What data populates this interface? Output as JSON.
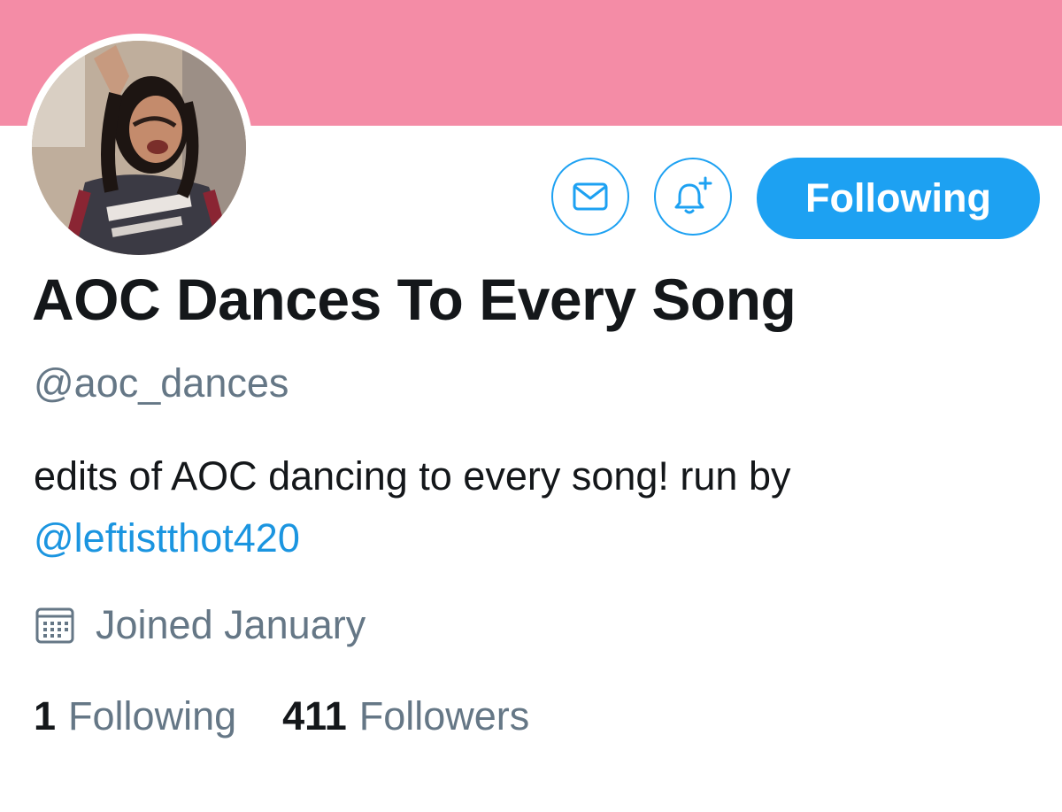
{
  "colors": {
    "banner": "#f48ca6",
    "accent": "#1da1f2",
    "link": "#1b95e0",
    "secondary_text": "#657786",
    "primary_text": "#14171a"
  },
  "profile": {
    "display_name": "AOC Dances To Every Song",
    "handle": "@aoc_dances",
    "bio_text": "edits of AOC dancing to every song! run by ",
    "bio_mention": "@leftistthot420",
    "joined": "Joined January",
    "avatar_icon": "profile-photo"
  },
  "actions": {
    "message_icon": "envelope-icon",
    "notify_icon": "bell-plus-icon",
    "follow_label": "Following"
  },
  "stats": {
    "following_count": "1",
    "following_label": "Following",
    "followers_count": "411",
    "followers_label": "Followers"
  }
}
